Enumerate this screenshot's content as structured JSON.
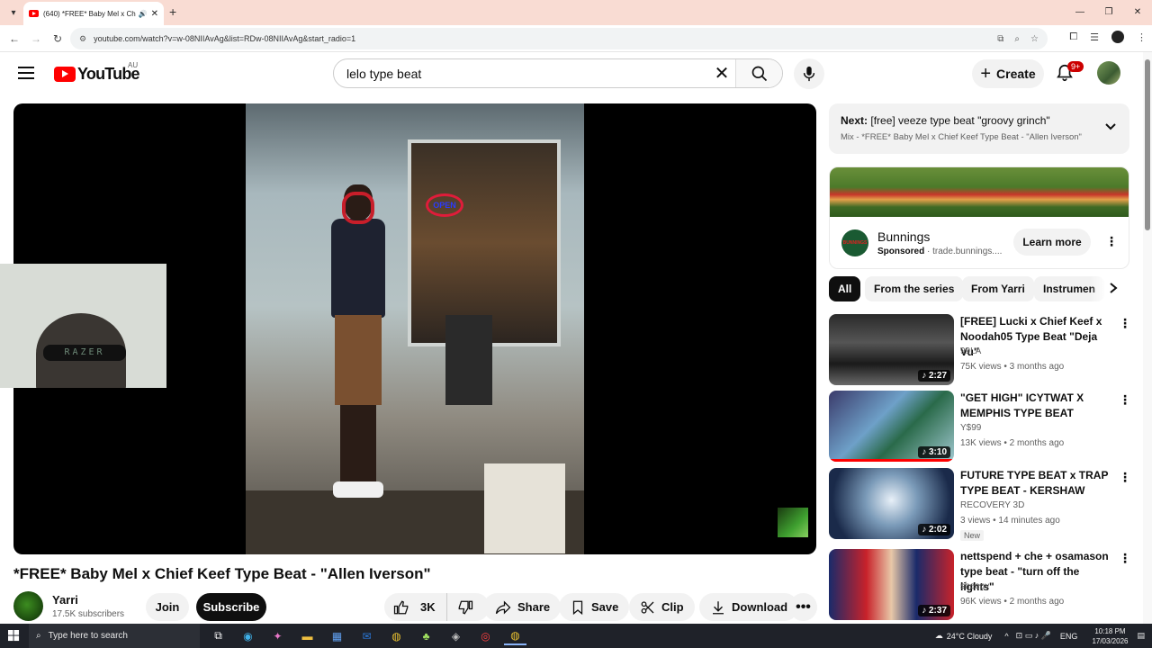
{
  "browser": {
    "tab_title": "(640) *FREE* Baby Mel x Ch",
    "url": "youtube.com/watch?v=w-08NIIAvAg&list=RDw-08NIIAvAg&start_radio=1"
  },
  "header": {
    "logo_text": "YouTube",
    "region": "AU",
    "search_value": "lelo type beat",
    "create_label": "Create",
    "notif_badge": "9+"
  },
  "video": {
    "title": "*FREE* Baby Mel x Chief Keef Type Beat - \"Allen Iverson\"",
    "webcam_text": "RAZER",
    "frame_sign": "OPEN"
  },
  "owner": {
    "channel": "Yarri",
    "subscribers": "17.5K subscribers",
    "join": "Join",
    "subscribe": "Subscribe",
    "likes": "3K",
    "share": "Share",
    "save": "Save",
    "clip": "Clip",
    "download": "Download"
  },
  "next": {
    "label": "Next:",
    "title": "[free] veeze type beat \"groovy grinch\"",
    "subtitle": "Mix - *FREE* Baby Mel x Chief Keef Type Beat - \"Allen Iverson\""
  },
  "ad": {
    "name": "Bunnings",
    "sponsored": "Sponsored",
    "domain": "trade.bunnings....",
    "cta": "Learn more",
    "logo_text": "BUNNINGS"
  },
  "chips": [
    "All",
    "From the series",
    "From Yarri",
    "Instrumen"
  ],
  "recommendations": [
    {
      "title": "[FREE] Lucki x Chief Keef x Noodah05 Type Beat \"Deja Vu\"",
      "channel": "99LA",
      "meta": "75K views • 3 months ago",
      "duration": "2:27",
      "new": ""
    },
    {
      "title": "\"GET HIGH\" ICYTWAT X MEMPHIS TYPE BEAT",
      "channel": "Y$99",
      "meta": "13K views • 2 months ago",
      "duration": "3:10",
      "new": ""
    },
    {
      "title": "FUTURE TYPE BEAT x TRAP TYPE BEAT - KERSHAW",
      "channel": "RECOVERY 3D",
      "meta": "3 views • 14 minutes ago",
      "duration": "2:02",
      "new": "New"
    },
    {
      "title": "nettspend + che + osamason type beat - \"turn off the lights\"",
      "channel": "sheepy",
      "meta": "96K views • 2 months ago",
      "duration": "2:37",
      "new": ""
    }
  ],
  "taskbar": {
    "search_placeholder": "Type here to search",
    "weather": "24°C  Cloudy",
    "lang": "ENG",
    "time": "10:18 PM",
    "date": "17/03/2026"
  },
  "colors": {
    "accent": "#ff0000",
    "text": "#0f0f0f",
    "secondary_text": "#606060",
    "chip_bg": "#f2f2f2"
  }
}
